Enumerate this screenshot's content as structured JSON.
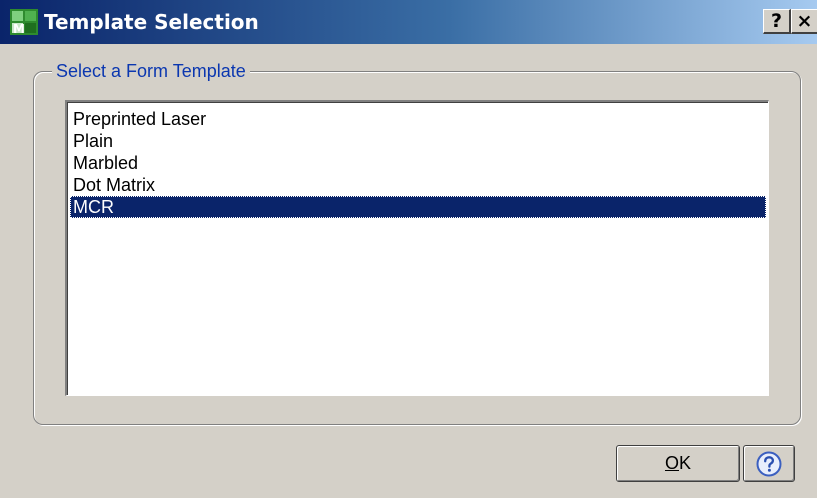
{
  "window": {
    "title": "Template Selection",
    "help_glyph": "?",
    "close_glyph": "×",
    "app_icon": "sage-mas-app-icon"
  },
  "group": {
    "legend": "Select a Form Template"
  },
  "list": {
    "items": [
      "Preprinted Laser",
      "Plain",
      "Marbled",
      "Dot Matrix",
      "MCR"
    ],
    "selected": "MCR"
  },
  "buttons": {
    "ok_mnemonic": "O",
    "ok_rest": "K",
    "help_icon": "question-circle-icon"
  },
  "colors": {
    "title_bar": "#0a246a",
    "legend_text": "#0b37b0",
    "selection": "#0a246a",
    "face": "#d4d0c8"
  }
}
